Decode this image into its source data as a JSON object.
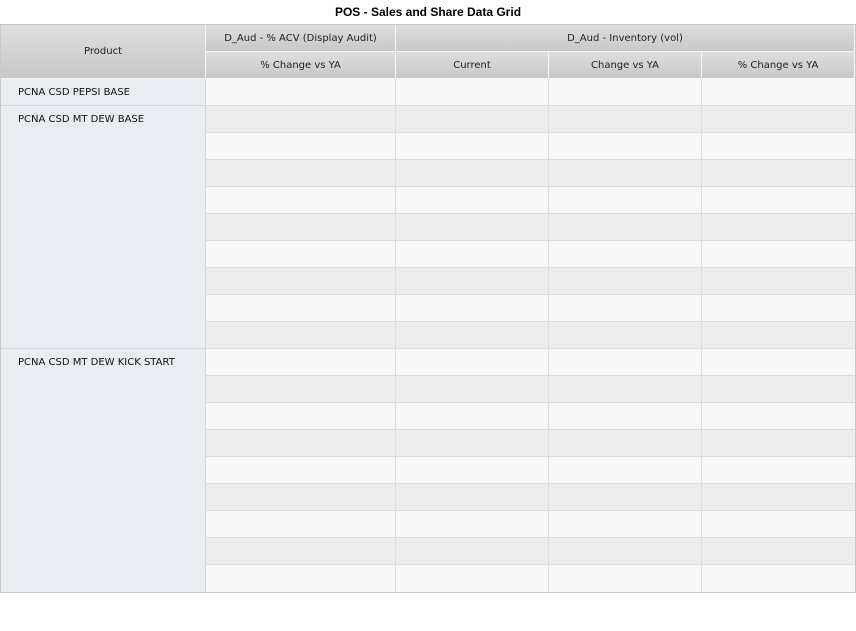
{
  "title": "POS - Sales and Share Data Grid",
  "headers": {
    "product": "Product",
    "group_acv": "D_Aud - % ACV (Display Audit)",
    "group_inventory": "D_Aud - Inventory (vol)",
    "acv_change": "% Change vs YA",
    "inv_current": "Current",
    "inv_change": "Change vs YA",
    "inv_pct_change": "% Change vs YA"
  },
  "products": [
    {
      "name": "PCNA CSD PEPSI BASE",
      "rows": 1
    },
    {
      "name": "PCNA CSD MT DEW BASE",
      "rows": 9
    },
    {
      "name": "PCNA CSD MT DEW KICK START",
      "rows": 9
    }
  ]
}
